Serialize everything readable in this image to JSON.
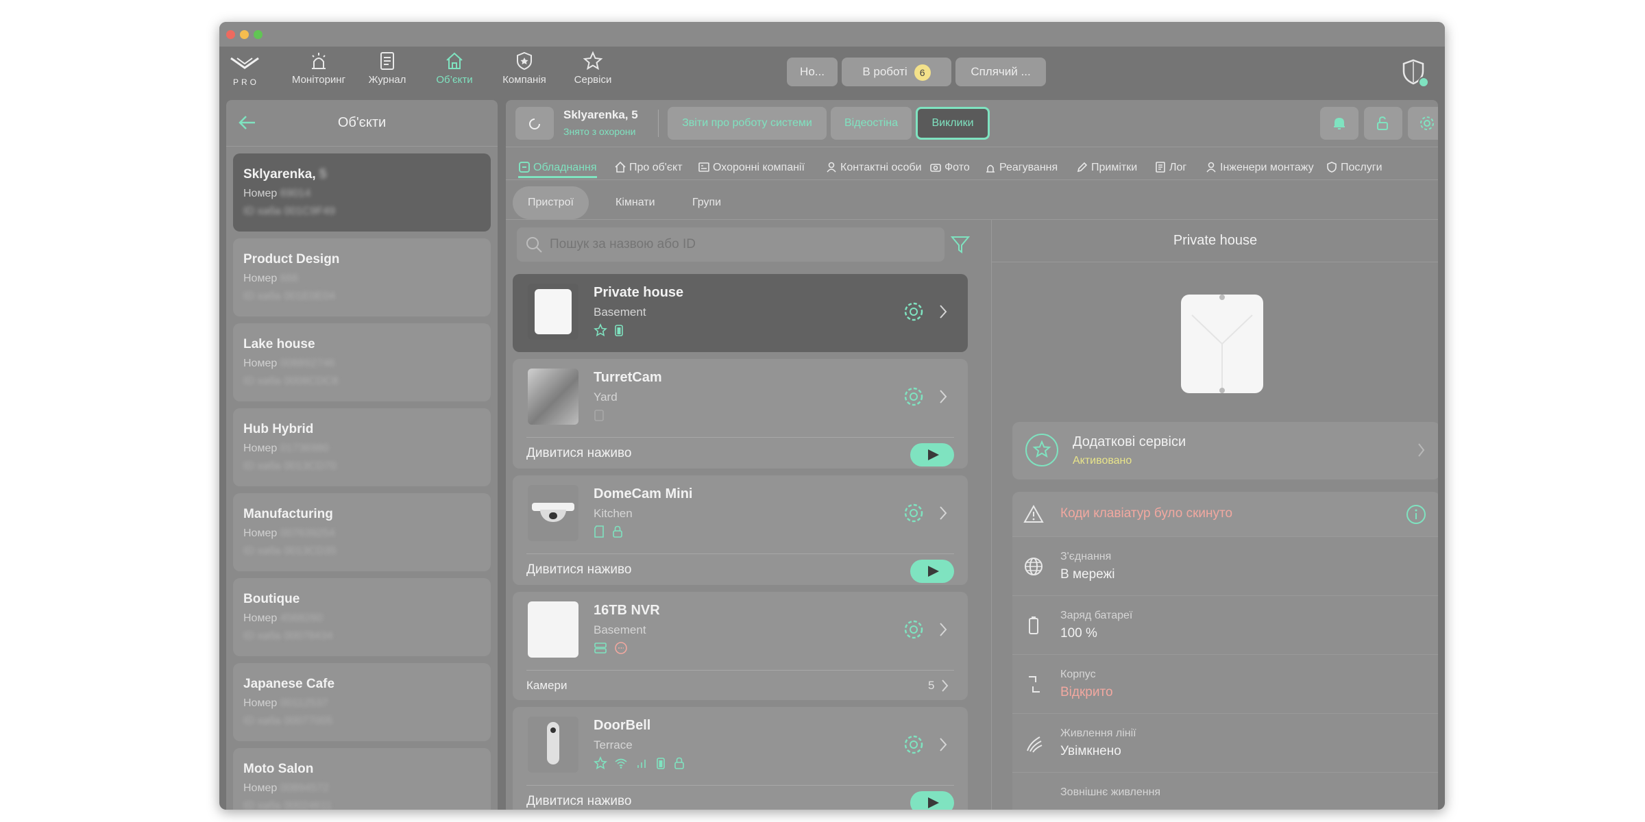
{
  "colors": {
    "accent": "#7fe3c0",
    "warning": "#f2a8a0",
    "active_yellow": "#f3e18a",
    "window_bg": "#757575"
  },
  "nav": {
    "items": [
      {
        "label": "Моніторинг",
        "icon": "siren-icon"
      },
      {
        "label": "Журнал",
        "icon": "journal-icon"
      },
      {
        "label": "Об’єкти",
        "icon": "house-icon"
      },
      {
        "label": "Компанія",
        "icon": "shield-star-icon"
      },
      {
        "label": "Сервіси",
        "icon": "star-icon"
      }
    ],
    "active": "Об’єкти",
    "logo_text": "PRO"
  },
  "status_pills": [
    {
      "label": "Но..."
    },
    {
      "label": "В роботі",
      "count": "6"
    },
    {
      "label": "Сплячий ..."
    }
  ],
  "left_panel": {
    "title": "Об'єкти",
    "objects": [
      {
        "name": "Sklyarenka,",
        "name_hidden": "5",
        "number_label": "Номер",
        "number": "69014",
        "hub_label": "ID хаба",
        "hub": "001C9F49",
        "selected": true
      },
      {
        "name": "Product Design",
        "number_label": "Номер",
        "number": "666",
        "hub_label": "ID хаба",
        "hub": "001E0E04"
      },
      {
        "name": "Lake house",
        "number_label": "Номер",
        "number": "008892746",
        "hub_label": "ID хаба",
        "hub": "0008CDC8"
      },
      {
        "name": "Hub Hybrid",
        "number_label": "Номер",
        "number": "01736980",
        "hub_label": "ID хаба",
        "hub": "0013CD70"
      },
      {
        "name": "Manufacturing",
        "number_label": "Номер",
        "number": "007639254",
        "hub_label": "ID хаба",
        "hub": "0013CD35"
      },
      {
        "name": "Boutique",
        "number_label": "Номер",
        "number": "4568260",
        "hub_label": "ID хаба",
        "hub": "00078434"
      },
      {
        "name": "Japanese Cafe",
        "number_label": "Номер",
        "number": "00112537",
        "hub_label": "ID хаба",
        "hub": "00077005"
      },
      {
        "name": "Moto Salon",
        "number_label": "Номер",
        "number": "00894572",
        "hub_label": "ID хаба",
        "hub": "00024611"
      }
    ]
  },
  "header": {
    "object_name": "Sklyarenka, 5",
    "object_status": "Знято з охорони",
    "buttons": [
      "Звіти про роботу системи",
      "Відеостіна",
      "Виклики"
    ]
  },
  "tabs": [
    "Обладнання",
    "Про об'єкт",
    "Охоронні компанії",
    "Контактні особи",
    "Фото",
    "Реагування",
    "Примітки",
    "Лог",
    "Інженери монтажу",
    "Послуги"
  ],
  "subtabs": [
    "Пристрої",
    "Кімнати",
    "Групи"
  ],
  "search": {
    "placeholder": "Пошук за назвою або ID"
  },
  "devices": [
    {
      "name": "Private house",
      "room": "Basement",
      "selected": true
    },
    {
      "name": "TurretCam",
      "room": "Yard",
      "action": "Дивитися наживо"
    },
    {
      "name": "DomeCam Mini",
      "room": "Kitchen",
      "action": "Дивитися наживо"
    },
    {
      "name": "16TB NVR",
      "room": "Basement",
      "footer_label": "Камери",
      "footer_count": "5"
    },
    {
      "name": "DoorBell",
      "room": "Terrace",
      "action": "Дивитися наживо"
    }
  ],
  "detail": {
    "title": "Private house",
    "services": {
      "label": "Додаткові сервіси",
      "status": "Активовано"
    },
    "alert": "Коди клавіатур було скинуто",
    "props": [
      {
        "label": "З'єднання",
        "value": "В мережі"
      },
      {
        "label": "Заряд батареї",
        "value": "100 %"
      },
      {
        "label": "Корпус",
        "value": "Відкрито"
      },
      {
        "label": "Живлення лінії",
        "value": "Увімкнено"
      },
      {
        "label": "Зовнішнє живлення",
        "value": ""
      }
    ]
  }
}
